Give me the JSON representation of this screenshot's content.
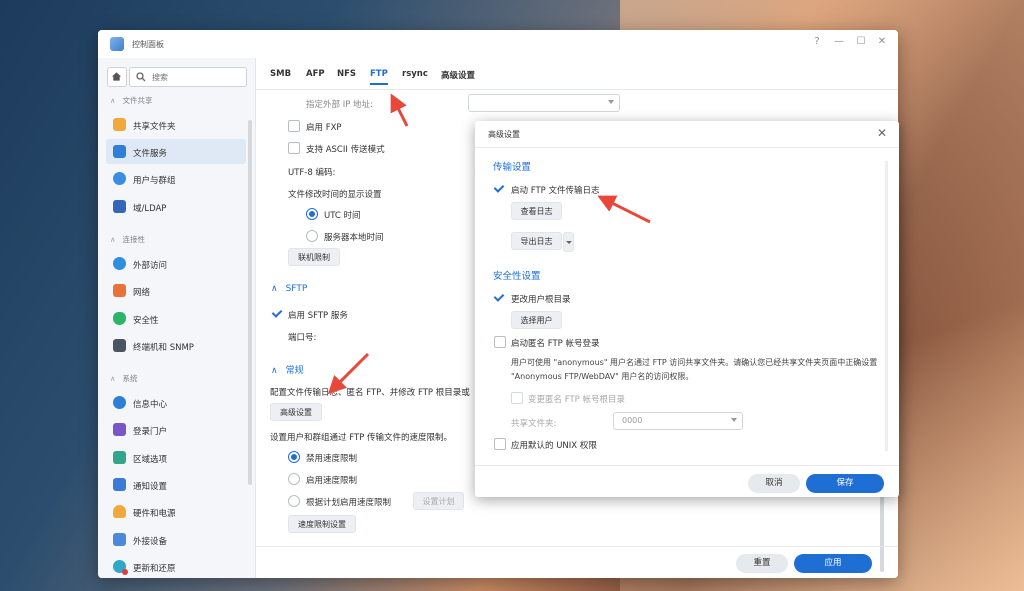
{
  "window": {
    "title": "控制面板",
    "controls": [
      "?",
      "—",
      "☐",
      "✕"
    ]
  },
  "sidebar": {
    "search_placeholder": "搜索",
    "categories": {
      "file_sharing": "文件共享",
      "connectivity": "连接性",
      "system": "系统"
    },
    "items": [
      {
        "label": "共享文件夹",
        "color": "#f2a93b"
      },
      {
        "label": "文件服务",
        "color": "#2f7fd8"
      },
      {
        "label": "用户与群组",
        "color": "#3a8de0"
      },
      {
        "label": "域/LDAP",
        "color": "#3566b8"
      },
      {
        "label": "外部访问",
        "color": "#2e8fe0"
      },
      {
        "label": "网络",
        "color": "#e8733a"
      },
      {
        "label": "安全性",
        "color": "#2cb56a"
      },
      {
        "label": "终端机和 SNMP",
        "color": "#4a5563"
      },
      {
        "label": "信息中心",
        "color": "#2f7fd8"
      },
      {
        "label": "登录门户",
        "color": "#7a55c9"
      },
      {
        "label": "区域选项",
        "color": "#33a58a"
      },
      {
        "label": "通知设置",
        "color": "#3a7bd5"
      },
      {
        "label": "硬件和电源",
        "color": "#f2a93b"
      },
      {
        "label": "外接设备",
        "color": "#4a8ad8"
      },
      {
        "label": "更新和还原",
        "color": "#2fa7c9"
      }
    ]
  },
  "tabs": [
    "SMB",
    "AFP",
    "NFS",
    "FTP",
    "rsync",
    "高级设置"
  ],
  "active_tab": "FTP",
  "ftp": {
    "external_ip_label": "指定外部 IP 地址:",
    "enable_fxp": "启用 FXP",
    "ascii_mode": "支持 ASCII 传送模式",
    "utf8_label": "UTF-8 编码:",
    "time_display_label": "文件修改时间的显示设置",
    "utc_time": "UTC 时间",
    "server_local_time": "服务器本地时间",
    "connection_limit_btn": "联机限制",
    "sftp_section": "SFTP",
    "enable_sftp": "启用 SFTP 服务",
    "port_label": "端口号:",
    "general_section": "常规",
    "general_desc": "配置文件传输日志、匿名 FTP、并修改 FTP 根目录或",
    "advanced_btn": "高级设置",
    "speed_desc": "设置用户和群组通过 FTP 传输文件的速度限制。",
    "disable_speed": "禁用速度限制",
    "enable_speed": "启用速度限制",
    "schedule_speed": "根据计划启用速度限制",
    "set_schedule_btn": "设置计划",
    "speed_settings_btn": "速度限制设置",
    "reset_btn": "重置",
    "apply_btn": "应用"
  },
  "dialog": {
    "title": "高级设置",
    "close": "✕",
    "transfer_section": "传输设置",
    "enable_log": "启动 FTP 文件传输日志",
    "view_log_btn": "查看日志",
    "export_log_btn": "导出日志",
    "security_section": "安全性设置",
    "change_root": "更改用户根目录",
    "select_user_btn": "选择用户",
    "anon_login": "启动匿名 FTP 帐号登录",
    "anon_desc": "用户可使用 \"anonymous\" 用户名通过 FTP 访问共享文件夹。请确认您已经共享文件夹页面中正确设置 \"Anonymous FTP/WebDAV\" 用户名的访问权限。",
    "change_anon_root": "变更匿名 FTP 帐号根目录",
    "shared_folder_label": "共享文件夹:",
    "shared_folder_value": "0000",
    "apply_unix": "应用默认的 UNIX 权限",
    "cancel_btn": "取消",
    "save_btn": "保存"
  }
}
